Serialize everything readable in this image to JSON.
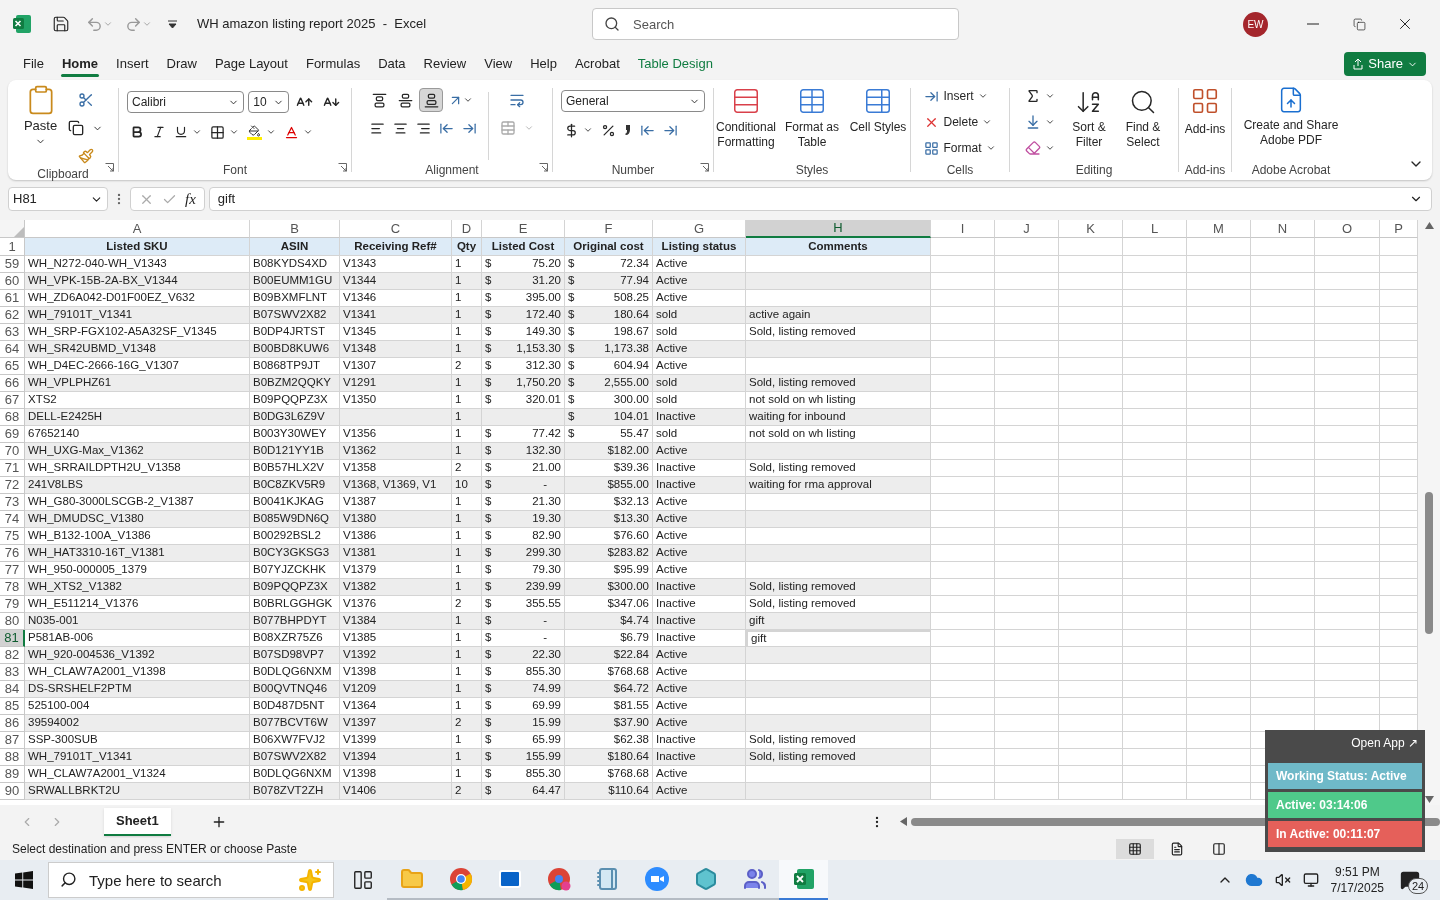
{
  "title_bar": {
    "title": "WH amazon listing report 2025  -  Excel",
    "search": {
      "placeholder": "Search"
    },
    "avatar": "EW"
  },
  "menu_tabs": [
    {
      "label": "File",
      "selected": false,
      "kind": "normal"
    },
    {
      "label": "Home",
      "selected": true,
      "kind": "normal"
    },
    {
      "label": "Insert",
      "selected": false,
      "kind": "normal"
    },
    {
      "label": "Draw",
      "selected": false,
      "kind": "normal"
    },
    {
      "label": "Page Layout",
      "selected": false,
      "kind": "normal"
    },
    {
      "label": "Formulas",
      "selected": false,
      "kind": "normal"
    },
    {
      "label": "Data",
      "selected": false,
      "kind": "normal"
    },
    {
      "label": "Review",
      "selected": false,
      "kind": "normal"
    },
    {
      "label": "View",
      "selected": false,
      "kind": "normal"
    },
    {
      "label": "Help",
      "selected": false,
      "kind": "normal"
    },
    {
      "label": "Acrobat",
      "selected": false,
      "kind": "normal"
    },
    {
      "label": "Table Design",
      "selected": false,
      "kind": "contextual"
    }
  ],
  "share": "Share",
  "ribbon": {
    "clipboard": {
      "label": "Clipboard",
      "paste": "Paste"
    },
    "font": {
      "label": "Font",
      "family": "Calibri",
      "size": "10"
    },
    "alignment": {
      "label": "Alignment",
      "vertical_align": [
        {
          "kind": "top",
          "selected": false
        },
        {
          "kind": "middle",
          "selected": false
        },
        {
          "kind": "bottom",
          "selected": true
        }
      ]
    },
    "number": {
      "label": "Number",
      "format": "General"
    },
    "styles": {
      "label": "Styles",
      "buttons": [
        {
          "kind": "conditional",
          "label": "Conditional Formatting"
        },
        {
          "kind": "table",
          "label": "Format as Table"
        },
        {
          "kind": "cell",
          "label": "Cell Styles"
        }
      ]
    },
    "cells": {
      "label": "Cells",
      "buttons": [
        {
          "kind": "insert",
          "label": "Insert"
        },
        {
          "kind": "delete",
          "label": "Delete"
        },
        {
          "kind": "format",
          "label": "Format"
        }
      ]
    },
    "editing": {
      "label": "Editing",
      "buttons": [
        {
          "kind": "sort",
          "label": "Sort & Filter"
        },
        {
          "kind": "find",
          "label": "Find & Select"
        }
      ]
    },
    "addins": {
      "label": "Add-ins",
      "button": "Add-ins"
    },
    "acrobat": {
      "label": "Adobe Acrobat",
      "button": "Create and Share Adobe PDF"
    }
  },
  "formula_bar": {
    "name_box": "H81",
    "fx": "fx",
    "value": "gift"
  },
  "columns": [
    {
      "letter": "A",
      "selected": false
    },
    {
      "letter": "B",
      "selected": false
    },
    {
      "letter": "C",
      "selected": false
    },
    {
      "letter": "D",
      "selected": false
    },
    {
      "letter": "E",
      "selected": false
    },
    {
      "letter": "F",
      "selected": false
    },
    {
      "letter": "G",
      "selected": false
    },
    {
      "letter": "H",
      "selected": true
    },
    {
      "letter": "I",
      "selected": false
    },
    {
      "letter": "J",
      "selected": false
    },
    {
      "letter": "K",
      "selected": false
    },
    {
      "letter": "L",
      "selected": false
    },
    {
      "letter": "M",
      "selected": false
    },
    {
      "letter": "N",
      "selected": false
    },
    {
      "letter": "O",
      "selected": false
    },
    {
      "letter": "P",
      "selected": false
    }
  ],
  "header_row": {
    "number": "1",
    "cells": [
      "Listed SKU",
      "ASIN",
      "Receiving Ref#",
      "Qty",
      "Listed Cost",
      "Original cost",
      "Listing status",
      "Comments"
    ]
  },
  "rows": [
    {
      "number": "59",
      "sku": "WH_N272-040-WH_V1343",
      "asin": "B08KYDS4XD",
      "ref": "V1343",
      "qty": "1",
      "listed_cost": {
        "sign": "$",
        "amount": "75.20"
      },
      "original_cost": {
        "sign": "$",
        "amount": "72.34"
      },
      "status": "Active",
      "selected": false
    },
    {
      "number": "60",
      "sku": "WH_VPK-15B-2A-BX_V1344",
      "asin": "B00EUMM1GU",
      "ref": "V1344",
      "qty": "1",
      "listed_cost": {
        "sign": "$",
        "amount": "31.20"
      },
      "original_cost": {
        "sign": "$",
        "amount": "77.94"
      },
      "status": "Active",
      "selected": false
    },
    {
      "number": "61",
      "sku": "WH_ZD6A042-D01F00EZ_V632",
      "asin": "B09BXMFLNT",
      "ref": "V1346",
      "qty": "1",
      "listed_cost": {
        "sign": "$",
        "amount": "395.00"
      },
      "original_cost": {
        "sign": "$",
        "amount": "508.25"
      },
      "status": "Active",
      "selected": false
    },
    {
      "number": "62",
      "sku": "WH_79101T_V1341",
      "asin": "B07SWV2X82",
      "ref": "V1341",
      "qty": "1",
      "listed_cost": {
        "sign": "$",
        "amount": "172.40"
      },
      "original_cost": {
        "sign": "$",
        "amount": "180.64"
      },
      "status": "sold",
      "comment": "active again",
      "selected": false
    },
    {
      "number": "63",
      "sku": "WH_SRP-FGX102-A5A32SF_V1345",
      "asin": "B0DP4JRTST",
      "ref": "V1345",
      "qty": "1",
      "listed_cost": {
        "sign": "$",
        "amount": "149.30"
      },
      "original_cost": {
        "sign": "$",
        "amount": "198.67"
      },
      "status": "sold",
      "comment": "Sold, listing removed",
      "selected": false
    },
    {
      "number": "64",
      "sku": "WH_SR42UBMD_V1348",
      "asin": "B00BD8KUW6",
      "ref": "V1348",
      "qty": "1",
      "listed_cost": {
        "sign": "$",
        "amount": "1,153.30"
      },
      "original_cost": {
        "sign": "$",
        "amount": "1,173.38"
      },
      "status": "Active",
      "selected": false
    },
    {
      "number": "65",
      "sku": "WH_D4EC-2666-16G_V1307",
      "asin": "B0868TP9JT",
      "ref": "V1307",
      "qty": "2",
      "listed_cost": {
        "sign": "$",
        "amount": "312.30"
      },
      "original_cost": {
        "sign": "$",
        "amount": "604.94"
      },
      "status": "Active",
      "selected": false
    },
    {
      "number": "66",
      "sku": "WH_VPLPHZ61",
      "asin": "B0BZM2QQKY",
      "ref": "V1291",
      "qty": "1",
      "listed_cost": {
        "sign": "$",
        "amount": "1,750.20"
      },
      "original_cost": {
        "sign": "$",
        "amount": "2,555.00"
      },
      "status": "sold",
      "comment": "Sold, listing removed",
      "selected": false
    },
    {
      "number": "67",
      "sku": "XTS2",
      "asin": "B09PQQPZ3X",
      "ref": "V1350",
      "qty": "1",
      "listed_cost": {
        "sign": "$",
        "amount": "320.01"
      },
      "original_cost": {
        "sign": "$",
        "amount": "300.00"
      },
      "status": "sold",
      "comment": "not sold on wh listing",
      "selected": false
    },
    {
      "number": "68",
      "sku": "DELL-E2425H",
      "asin": "B0DG3L6Z9V",
      "qty": "1",
      "original_cost": {
        "sign": "$",
        "amount": "104.01"
      },
      "status": "Inactive",
      "comment": "waiting for inbound",
      "selected": false
    },
    {
      "number": "69",
      "sku": "67652140",
      "asin": "B003Y30WEY",
      "ref": "V1356",
      "qty": "1",
      "listed_cost": {
        "sign": "$",
        "amount": "77.42"
      },
      "original_cost": {
        "sign": "$",
        "amount": "55.47"
      },
      "status": "sold",
      "comment": "not sold on wh listing",
      "selected": false
    },
    {
      "number": "70",
      "sku": "WH_UXG-Max_V1362",
      "asin": "B0D121YY1B",
      "ref": "V1362",
      "qty": "1",
      "listed_cost": {
        "sign": "$",
        "amount": "132.30"
      },
      "original_cost": {
        "amount": "$182.00"
      },
      "status": "Active",
      "selected": false
    },
    {
      "number": "71",
      "sku": "WH_SRRAILDPTH2U_V1358",
      "asin": "B0B57HLX2V",
      "ref": "V1358",
      "qty": "2",
      "listed_cost": {
        "sign": "$",
        "amount": "21.00"
      },
      "original_cost": {
        "amount": "$39.36"
      },
      "status": "Inactive",
      "comment": "Sold, listing removed",
      "selected": false
    },
    {
      "number": "72",
      "sku": "241V8LBS",
      "asin": "B0C8ZKV5R9",
      "ref": "V1368, V1369, V1",
      "qty": "10",
      "listed_cost": {
        "sign": "$",
        "amount": "-"
      },
      "original_cost": {
        "amount": "$855.00"
      },
      "status": "Inactive",
      "comment": "waiting for rma approval",
      "selected": false
    },
    {
      "number": "73",
      "sku": "WH_G80-3000LSCGB-2_V1387",
      "asin": "B0041KJKAG",
      "ref": "V1387",
      "qty": "1",
      "listed_cost": {
        "sign": "$",
        "amount": "21.30"
      },
      "original_cost": {
        "amount": "$32.13"
      },
      "status": "Active",
      "selected": false
    },
    {
      "number": "74",
      "sku": "WH_DMUDSC_V1380",
      "asin": "B085W9DN6Q",
      "ref": "V1380",
      "qty": "1",
      "listed_cost": {
        "sign": "$",
        "amount": "19.30"
      },
      "original_cost": {
        "amount": "$13.30"
      },
      "status": "Active",
      "selected": false
    },
    {
      "number": "75",
      "sku": "WH_B132-100A_V1386",
      "asin": "B00292BSL2",
      "ref": "V1386",
      "qty": "1",
      "listed_cost": {
        "sign": "$",
        "amount": "82.90"
      },
      "original_cost": {
        "amount": "$76.60"
      },
      "status": "Active",
      "selected": false
    },
    {
      "number": "76",
      "sku": "WH_HAT3310-16T_V1381",
      "asin": "B0CY3GKSG3",
      "ref": "V1381",
      "qty": "1",
      "listed_cost": {
        "sign": "$",
        "amount": "299.30"
      },
      "original_cost": {
        "amount": "$283.82"
      },
      "status": "Active",
      "selected": false
    },
    {
      "number": "77",
      "sku": "WH_950-000005_1379",
      "asin": "B07YJZCKHK",
      "ref": "V1379",
      "qty": "1",
      "listed_cost": {
        "sign": "$",
        "amount": "79.30"
      },
      "original_cost": {
        "amount": "$95.99"
      },
      "status": "Active",
      "selected": false
    },
    {
      "number": "78",
      "sku": "WH_XTS2_V1382",
      "asin": "B09PQQPZ3X",
      "ref": "V1382",
      "qty": "1",
      "listed_cost": {
        "sign": "$",
        "amount": "239.99"
      },
      "original_cost": {
        "amount": "$300.00"
      },
      "status": "Inactive",
      "comment": "Sold, listing removed",
      "selected": false
    },
    {
      "number": "79",
      "sku": "WH_E511214_V1376",
      "asin": "B0BRLGGHGK",
      "ref": "V1376",
      "qty": "2",
      "listed_cost": {
        "sign": "$",
        "amount": "355.55"
      },
      "original_cost": {
        "amount": "$347.06"
      },
      "status": "Inactive",
      "comment": "Sold, listing removed",
      "selected": false
    },
    {
      "number": "80",
      "sku": "N035-001",
      "asin": "B077BHPDYT",
      "ref": "V1384",
      "qty": "1",
      "listed_cost": {
        "sign": "$",
        "amount": "-"
      },
      "original_cost": {
        "amount": "$4.74"
      },
      "status": "Inactive",
      "comment": "gift",
      "selected": false
    },
    {
      "number": "81",
      "sku": "P581AB-006",
      "asin": "B08XZR75Z6",
      "ref": "V1385",
      "qty": "1",
      "listed_cost": {
        "sign": "$",
        "amount": "-"
      },
      "original_cost": {
        "amount": "$6.79"
      },
      "status": "Inactive",
      "comment": "gift",
      "selected": true
    },
    {
      "number": "82",
      "sku": "WH_920-004536_V1392",
      "asin": "B07SD98VP7",
      "ref": "V1392",
      "qty": "1",
      "listed_cost": {
        "sign": "$",
        "amount": "22.30"
      },
      "original_cost": {
        "amount": "$22.84"
      },
      "status": "Active",
      "selected": false
    },
    {
      "number": "83",
      "sku": "WH_CLAW7A2001_V1398",
      "asin": "B0DLQG6NXM",
      "ref": "V1398",
      "qty": "1",
      "listed_cost": {
        "sign": "$",
        "amount": "855.30"
      },
      "original_cost": {
        "amount": "$768.68"
      },
      "status": "Active",
      "selected": false
    },
    {
      "number": "84",
      "sku": "DS-SRSHELF2PTM",
      "asin": "B00QVTNQ46",
      "ref": "V1209",
      "qty": "1",
      "listed_cost": {
        "sign": "$",
        "amount": "74.99"
      },
      "original_cost": {
        "amount": "$64.72"
      },
      "status": "Active",
      "selected": false
    },
    {
      "number": "85",
      "sku": "525100-004",
      "asin": "B0D487D5NT",
      "ref": "V1364",
      "qty": "1",
      "listed_cost": {
        "sign": "$",
        "amount": "69.99"
      },
      "original_cost": {
        "amount": "$81.55"
      },
      "status": "Active",
      "selected": false
    },
    {
      "number": "86",
      "sku": "39594002",
      "asin": "B077BCVT6W",
      "ref": "V1397",
      "qty": "2",
      "listed_cost": {
        "sign": "$",
        "amount": "15.99"
      },
      "original_cost": {
        "amount": "$37.90"
      },
      "status": "Active",
      "selected": false
    },
    {
      "number": "87",
      "sku": "SSP-300SUB",
      "asin": "B06XW7FVJ2",
      "ref": "V1399",
      "qty": "1",
      "listed_cost": {
        "sign": "$",
        "amount": "65.99"
      },
      "original_cost": {
        "amount": "$62.38"
      },
      "status": "Inactive",
      "comment": "Sold, listing removed",
      "selected": false
    },
    {
      "number": "88",
      "sku": "WH_79101T_V1341",
      "asin": "B07SWV2X82",
      "ref": "V1394",
      "qty": "1",
      "listed_cost": {
        "sign": "$",
        "amount": "155.99"
      },
      "original_cost": {
        "amount": "$180.64"
      },
      "status": "Inactive",
      "comment": "Sold, listing removed",
      "selected": false
    },
    {
      "number": "89",
      "sku": "WH_CLAW7A2001_V1324",
      "asin": "B0DLQG6NXM",
      "ref": "V1398",
      "qty": "1",
      "listed_cost": {
        "sign": "$",
        "amount": "855.30"
      },
      "original_cost": {
        "amount": "$768.68"
      },
      "status": "Active",
      "selected": false
    },
    {
      "number": "90",
      "sku": "SRWALLBRKT2U",
      "asin": "B078ZVT2ZH",
      "ref": "V1406",
      "qty": "2",
      "listed_cost": {
        "sign": "$",
        "amount": "64.47"
      },
      "original_cost": {
        "amount": "$110.64"
      },
      "status": "Active",
      "selected": false
    }
  ],
  "sheet_tabs": [
    {
      "label": "Sheet1",
      "selected": true
    }
  ],
  "status_bar": {
    "message": "Select destination and press ENTER or choose Paste",
    "views": [
      {
        "kind": "normal",
        "selected": true
      },
      {
        "kind": "page-layout",
        "selected": false
      },
      {
        "kind": "page-break",
        "selected": false
      }
    ]
  },
  "tracker": {
    "open_app": "Open App ↗",
    "items": [
      {
        "text": "Working Status: Active",
        "color": "#6fb9c8"
      },
      {
        "text": "Active: 03:14:06",
        "color": "#4fc98a"
      },
      {
        "text": "In Active: 00:11:07",
        "color": "#e5605a"
      }
    ]
  },
  "taskbar": {
    "search": {
      "placeholder": "Type here to search"
    },
    "apps": [
      {
        "kind": "task-view",
        "active": false
      },
      {
        "kind": "folder",
        "active": false
      },
      {
        "kind": "browser",
        "active": false
      },
      {
        "kind": "mail",
        "active": false
      },
      {
        "kind": "browser-profile",
        "active": false
      },
      {
        "kind": "notepad",
        "active": false
      },
      {
        "kind": "video",
        "active": false
      },
      {
        "kind": "gem",
        "active": false
      },
      {
        "kind": "teams",
        "active": false
      },
      {
        "kind": "sheet",
        "active": true
      }
    ],
    "time": "9:51 PM",
    "date": "7/17/2025",
    "notifications": "24"
  }
}
